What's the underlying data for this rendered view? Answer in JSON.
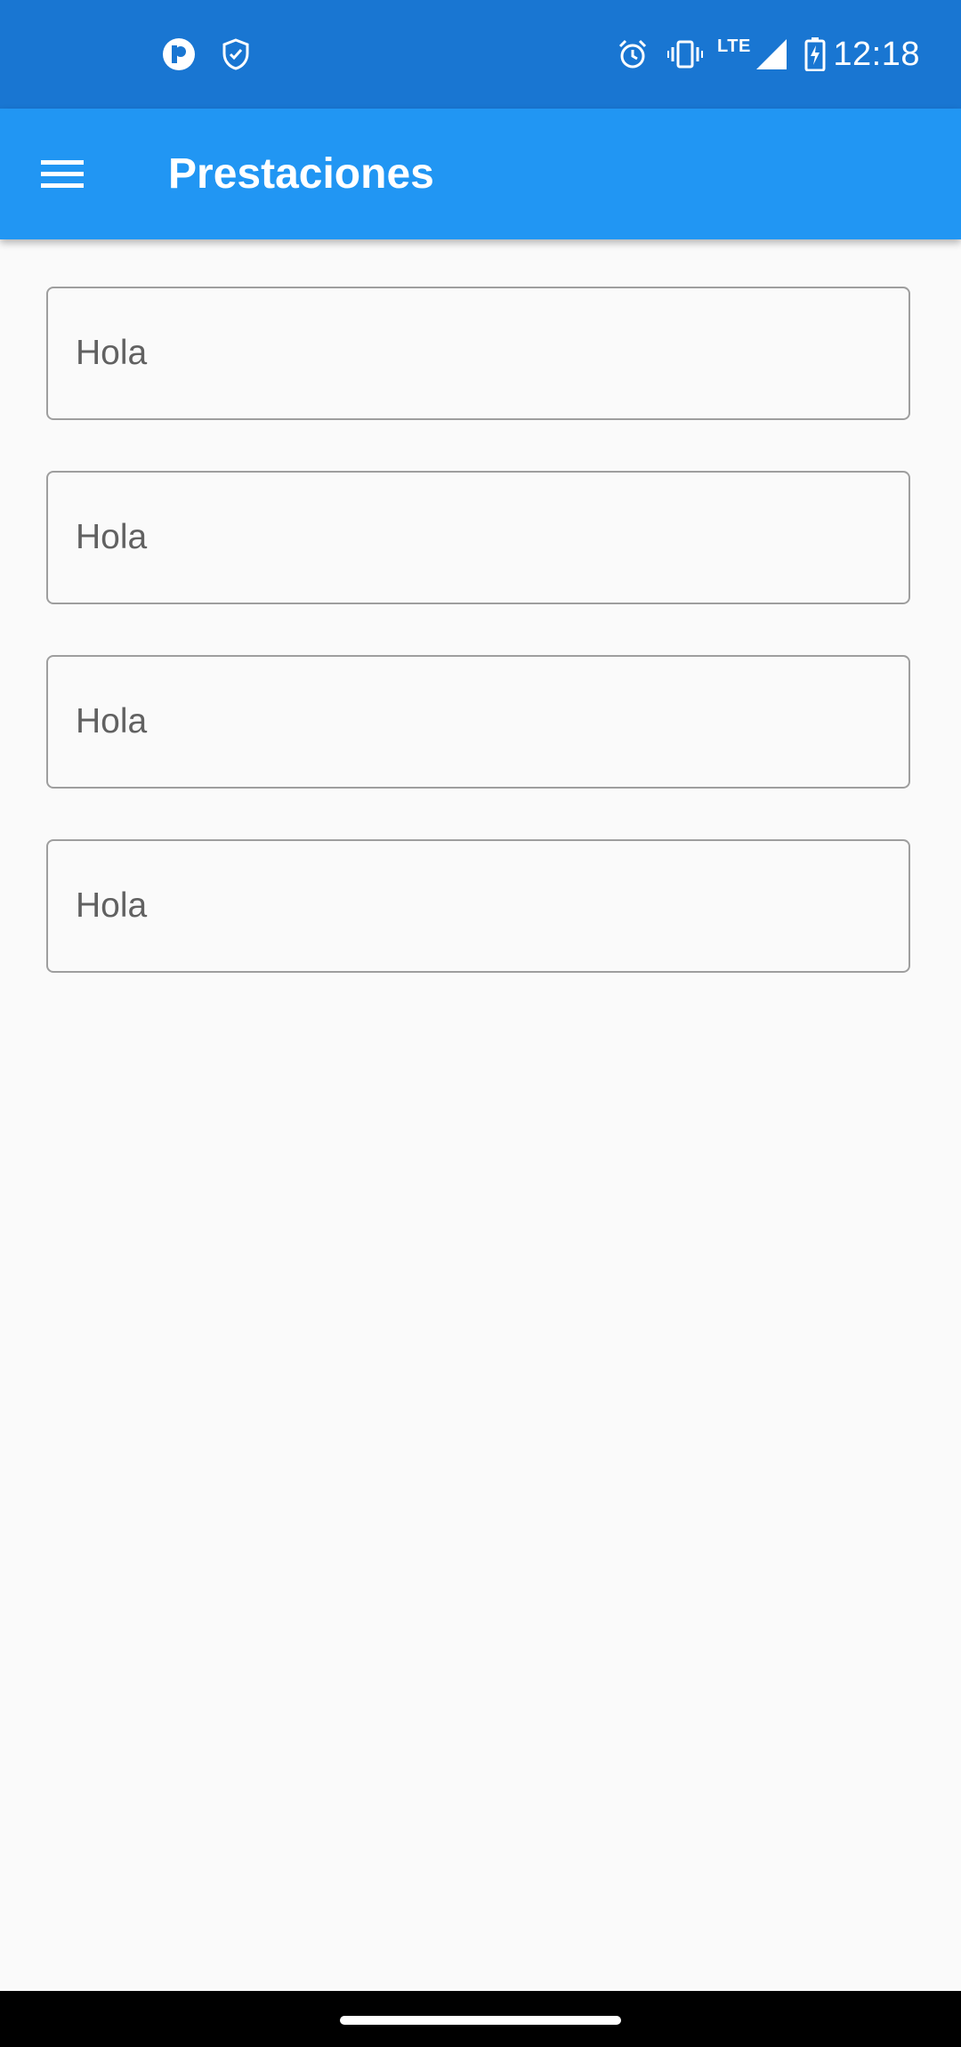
{
  "status_bar": {
    "time": "12:18",
    "network": "LTE",
    "left_icons": [
      "notification-app-icon",
      "shield-check-icon"
    ],
    "right_icons": [
      "alarm-icon",
      "vibrate-icon",
      "signal-icon",
      "battery-charging-icon"
    ],
    "background_color": "#1976d2"
  },
  "app_bar": {
    "title": "Prestaciones",
    "menu_icon": "menu-icon",
    "background_color": "#2196f3"
  },
  "fields": [
    {
      "value": "Hola"
    },
    {
      "value": "Hola"
    },
    {
      "value": "Hola"
    },
    {
      "value": "Hola"
    }
  ]
}
